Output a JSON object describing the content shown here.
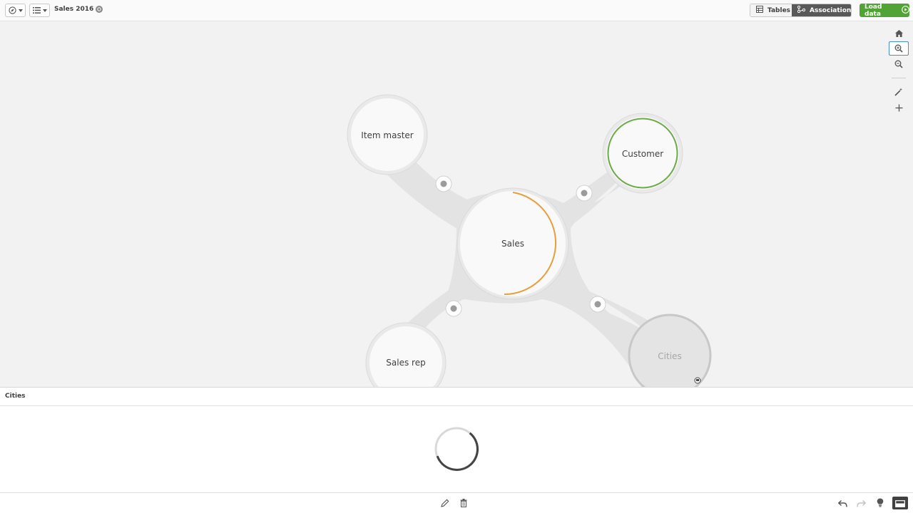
{
  "header": {
    "app_title": "Sales 2016",
    "tabs": [
      {
        "label": "Tables",
        "active": false
      },
      {
        "label": "Associations",
        "active": true
      }
    ],
    "load_label": "Load data"
  },
  "nodes": [
    {
      "id": "sales",
      "label": "Sales",
      "ring": "#e89e3c"
    },
    {
      "id": "item-master",
      "label": "Item master"
    },
    {
      "id": "customer",
      "label": "Customer",
      "ring": "#6aac45"
    },
    {
      "id": "sales-rep",
      "label": "Sales rep"
    },
    {
      "id": "cities",
      "label": "Cities",
      "state": "dimmed"
    }
  ],
  "preview": {
    "title": "Cities"
  },
  "colors": {
    "accent_green": "#52a335",
    "selected_blue": "#4a90c8"
  }
}
